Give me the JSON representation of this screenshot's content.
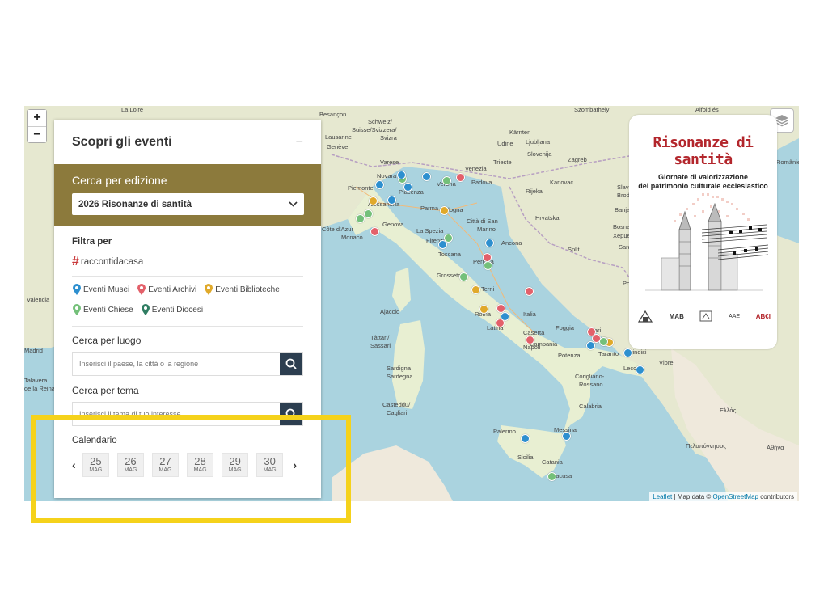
{
  "map": {
    "zoom_in": "+",
    "zoom_out": "−",
    "attribution": {
      "leaflet": "Leaflet",
      "sep": " | Map data © ",
      "osm": "OpenStreetMap",
      "tail": " contributors"
    },
    "labels": [
      {
        "text": "La Loire"
      },
      {
        "text": "Besançon"
      },
      {
        "text": "Schweiz/"
      },
      {
        "text": "Suisse/Svizzera/"
      },
      {
        "text": "Svizra"
      },
      {
        "text": "Lausanne"
      },
      {
        "text": "Genève"
      },
      {
        "text": "Varese"
      },
      {
        "text": "Novara"
      },
      {
        "text": "Piemonte"
      },
      {
        "text": "Alessandria"
      },
      {
        "text": "Piacenza"
      },
      {
        "text": "Verona"
      },
      {
        "text": "Venezia"
      },
      {
        "text": "Padova"
      },
      {
        "text": "Bologna"
      },
      {
        "text": "Parma"
      },
      {
        "text": "Genova"
      },
      {
        "text": "Monaco"
      },
      {
        "text": "Côte d'Azur"
      },
      {
        "text": "La Spezia"
      },
      {
        "text": "Firenze"
      },
      {
        "text": "Toscana"
      },
      {
        "text": "Città di San"
      },
      {
        "text": "Marino"
      },
      {
        "text": "Ancona"
      },
      {
        "text": "Perugia"
      },
      {
        "text": "Grosseto"
      },
      {
        "text": "Terni"
      },
      {
        "text": "Roma"
      },
      {
        "text": "Latina"
      },
      {
        "text": "Italia"
      },
      {
        "text": "Napoli"
      },
      {
        "text": "Caserta"
      },
      {
        "text": "Campania"
      },
      {
        "text": "Foggia"
      },
      {
        "text": "Bari"
      },
      {
        "text": "Potenza"
      },
      {
        "text": "Taranto"
      },
      {
        "text": "Brindisi"
      },
      {
        "text": "Lecce"
      },
      {
        "text": "Corigliano-"
      },
      {
        "text": "Rossano"
      },
      {
        "text": "Calabria"
      },
      {
        "text": "Ajaccio"
      },
      {
        "text": "Tàttari/"
      },
      {
        "text": "Sassari"
      },
      {
        "text": "Sardigna"
      },
      {
        "text": "Sardegna"
      },
      {
        "text": "Casteddu/"
      },
      {
        "text": "Cagliari"
      },
      {
        "text": "Palermo"
      },
      {
        "text": "Messina"
      },
      {
        "text": "Sicilia"
      },
      {
        "text": "Catania"
      },
      {
        "text": "Siracusa"
      },
      {
        "text": "Udine"
      },
      {
        "text": "Trieste"
      },
      {
        "text": "Ljubljana"
      },
      {
        "text": "Slovenija"
      },
      {
        "text": "Zagreb"
      },
      {
        "text": "Karlovac"
      },
      {
        "text": "Rijeka"
      },
      {
        "text": "Hrvatska"
      },
      {
        "text": "Split"
      },
      {
        "text": "Banja Luka"
      },
      {
        "text": "Bosna i Herc"
      },
      {
        "text": "Херцег"
      },
      {
        "text": "Sarajevo"
      },
      {
        "text": "Podgorica"
      },
      {
        "text": "Szombathely"
      },
      {
        "text": "Kärnten"
      },
      {
        "text": "Slavonski"
      },
      {
        "text": "Brod"
      },
      {
        "text": "Vlorë"
      },
      {
        "text": "Ελλάς"
      },
      {
        "text": "Αθήνα"
      },
      {
        "text": "Πελοπόννησος"
      },
      {
        "text": "Valencia"
      },
      {
        "text": "Talavera"
      },
      {
        "text": "de la Reina"
      },
      {
        "text": "Madrid"
      },
      {
        "text": "Alfold és"
      },
      {
        "text": "Românie"
      }
    ],
    "pins": [
      {
        "color": "#2d8fcf"
      },
      {
        "color": "#2d8fcf"
      },
      {
        "color": "#2d8fcf"
      },
      {
        "color": "#e3606a"
      },
      {
        "color": "#74c07a"
      },
      {
        "color": "#74c07a"
      },
      {
        "color": "#2d8fcf"
      },
      {
        "color": "#e0a92a"
      },
      {
        "color": "#2d8fcf"
      },
      {
        "color": "#74c07a"
      },
      {
        "color": "#74c07a"
      },
      {
        "color": "#e3606a"
      },
      {
        "color": "#2d8fcf"
      },
      {
        "color": "#74c07a"
      },
      {
        "color": "#e0a92a"
      },
      {
        "color": "#2d8fcf"
      },
      {
        "color": "#e3606a"
      },
      {
        "color": "#74c07a"
      },
      {
        "color": "#e0a92a"
      },
      {
        "color": "#e3606a"
      },
      {
        "color": "#e0a92a"
      },
      {
        "color": "#74c07a"
      },
      {
        "color": "#e3606a"
      },
      {
        "color": "#2d8fcf"
      },
      {
        "color": "#e3606a"
      },
      {
        "color": "#e3606a"
      },
      {
        "color": "#e3606a"
      },
      {
        "color": "#74c07a"
      },
      {
        "color": "#e3606a"
      },
      {
        "color": "#e0a92a"
      },
      {
        "color": "#74c07a"
      },
      {
        "color": "#2d8fcf"
      },
      {
        "color": "#2d8fcf"
      },
      {
        "color": "#2d8fcf"
      },
      {
        "color": "#2d8fcf"
      },
      {
        "color": "#2d8fcf"
      },
      {
        "color": "#74c07a"
      }
    ]
  },
  "panel": {
    "title": "Scopri gli eventi",
    "collapse": "−",
    "edition_label": "Cerca per edizione",
    "edition_value": "2026 Risonanze di santità",
    "filter_label": "Filtra per",
    "hashtag": "raccontidacasa",
    "filters": [
      {
        "label": "Eventi Musei",
        "color": "#2d8fcf",
        "icon": "blue-pin-icon"
      },
      {
        "label": "Eventi Archivi",
        "color": "#e3606a",
        "icon": "red-pin-icon"
      },
      {
        "label": "Eventi Biblioteche",
        "color": "#e0a92a",
        "icon": "yellow-pin-icon"
      },
      {
        "label": "Eventi Chiese",
        "color": "#74c07a",
        "icon": "light-green-pin-icon"
      },
      {
        "label": "Eventi Diocesi",
        "color": "#2f7d62",
        "icon": "dark-green-pin-icon"
      }
    ],
    "place_label": "Cerca per luogo",
    "place_placeholder": "Inserisci il paese, la città o la regione",
    "theme_label": "Cerca per tema",
    "theme_placeholder": "Inserisci il tema di tuo interesse",
    "calendar_label": "Calendario",
    "prev": "‹",
    "next": "›",
    "days": [
      {
        "n": "25",
        "m": "MAG"
      },
      {
        "n": "26",
        "m": "MAG"
      },
      {
        "n": "27",
        "m": "MAG"
      },
      {
        "n": "28",
        "m": "MAG"
      },
      {
        "n": "29",
        "m": "MAG"
      },
      {
        "n": "30",
        "m": "MAG"
      }
    ]
  },
  "poster": {
    "title": "Risonanze di santità",
    "subtitle_line1": "Giornate di valorizzazione",
    "subtitle_line2": "del patrimonio culturale ecclesiastico",
    "logos": [
      "MAB",
      "AAE",
      "AB€I"
    ]
  },
  "colors": {
    "edition_bg": "#8c7a3c",
    "search_btn": "#2c3e50",
    "highlight": "#f5d21b",
    "poster_title": "#b3262c"
  }
}
